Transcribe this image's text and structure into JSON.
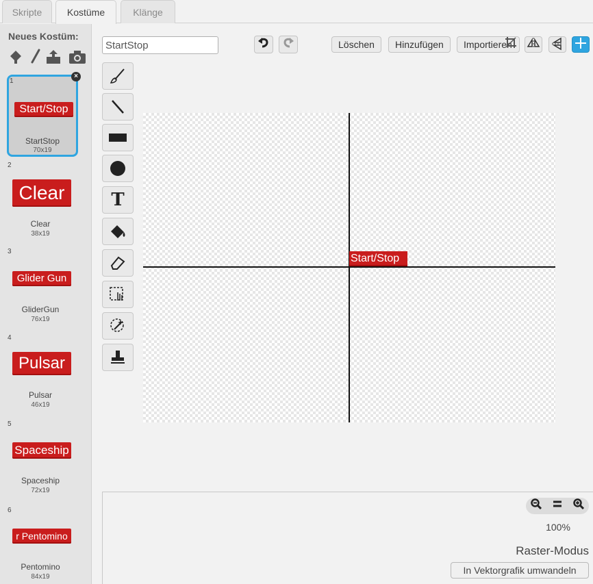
{
  "tabs": [
    {
      "label": "Skripte"
    },
    {
      "label": "Kostüme"
    },
    {
      "label": "Klänge"
    }
  ],
  "sidebar": {
    "new_costume_label": "Neues Kostüm:",
    "new_costume_icons": [
      "paint-new-icon",
      "brush-icon",
      "upload-icon",
      "camera-icon"
    ],
    "costumes": [
      {
        "num": "1",
        "thumb_text": "Start/Stop",
        "name": "StartStop",
        "size": "70x19",
        "selected": true
      },
      {
        "num": "2",
        "thumb_text": "Clear",
        "name": "Clear",
        "size": "38x19"
      },
      {
        "num": "3",
        "thumb_text": "Glider Gun",
        "name": "GliderGun",
        "size": "76x19"
      },
      {
        "num": "4",
        "thumb_text": "Pulsar",
        "name": "Pulsar",
        "size": "46x19"
      },
      {
        "num": "5",
        "thumb_text": "Spaceship",
        "name": "Spaceship",
        "size": "72x19"
      },
      {
        "num": "6",
        "thumb_text": "r Pentomino",
        "name": "Pentomino",
        "size": "84x19"
      }
    ]
  },
  "editor": {
    "costume_name": "StartStop",
    "buttons": {
      "clear": "Löschen",
      "add": "Hinzufügen",
      "import": "Importieren"
    },
    "tools": [
      "brush-icon",
      "line-icon",
      "rectangle-icon",
      "ellipse-icon",
      "text-icon",
      "fill-icon",
      "eraser-icon",
      "select-icon",
      "magic-select-icon",
      "stamp-icon"
    ],
    "canvas_sprite_text": "Start/Stop",
    "zoom_level": "100%",
    "mode_label": "Raster-Modus",
    "convert_label": "In Vektorgrafik umwandeln"
  },
  "colors": {
    "accent": "#2fa5e0",
    "sprite_red": "#c91d1d"
  }
}
